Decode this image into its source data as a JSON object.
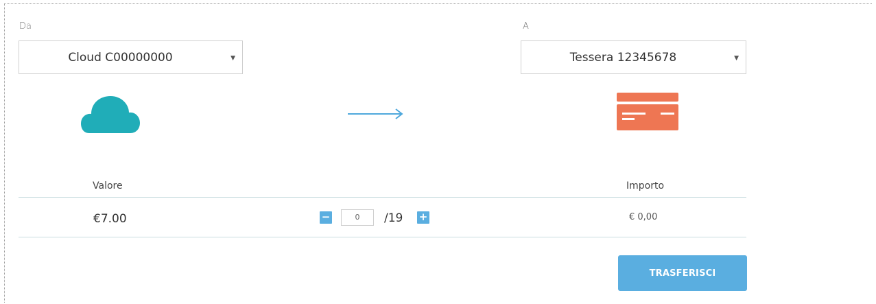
{
  "from": {
    "label": "Da",
    "selected": "Cloud C00000000",
    "icon": "cloud-icon",
    "icon_color": "#20adb8"
  },
  "to": {
    "label": "A",
    "selected": "Tessera 12345678",
    "icon": "credit-card-icon",
    "icon_color": "#ee7653"
  },
  "arrow": {
    "icon": "arrow-right-icon",
    "color": "#4ea8dc"
  },
  "table": {
    "col_value_header": "Valore",
    "col_amount_header": "Importo",
    "row": {
      "value": "€7.00",
      "quantity": "0",
      "max": "/19",
      "amount": "€ 0,00"
    }
  },
  "actions": {
    "transfer_label": "TRASFERISCI",
    "accent": "#5aaee0"
  }
}
